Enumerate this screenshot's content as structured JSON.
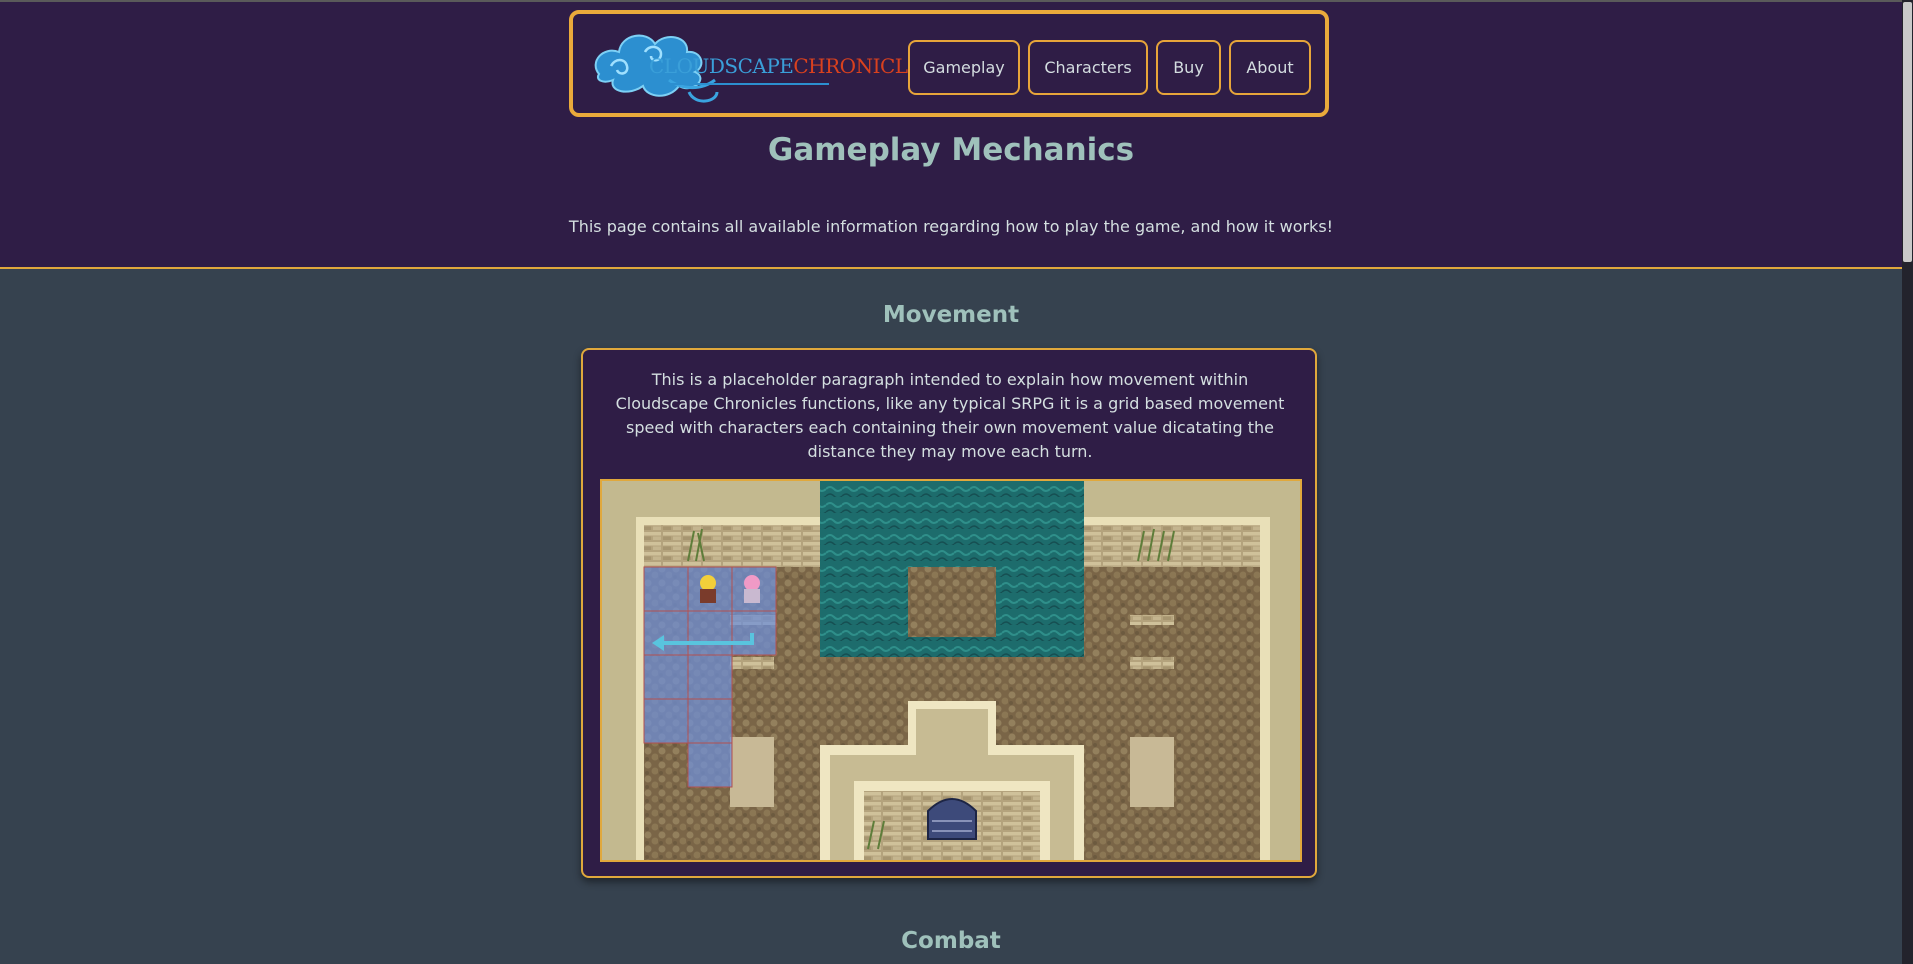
{
  "header": {
    "logo": {
      "part1": "CLOUDSCAPE",
      "part2": "CHRONICLES",
      "icon": "cloud-swirl-logo"
    },
    "nav": [
      {
        "label": "Gameplay"
      },
      {
        "label": "Characters"
      },
      {
        "label": "Buy"
      },
      {
        "label": "About"
      }
    ]
  },
  "page": {
    "title": "Gameplay Mechanics",
    "intro": "This page contains all available information regarding how to play the game, and how it works!"
  },
  "sections": [
    {
      "title": "Movement",
      "text": "This is a placeholder paragraph intended to explain how movement within Cloudscape Chronicles functions, like any typical SRPG it is a grid based movement speed with characters each containing their own movement value dicatating the distance they may move each turn.",
      "image": "movement-grid-map"
    },
    {
      "title": "Combat"
    }
  ],
  "colors": {
    "hero_bg": "#2f1d46",
    "body_bg": "#36424f",
    "accent_border": "#e0a83c",
    "heading": "#9fc1bb"
  }
}
